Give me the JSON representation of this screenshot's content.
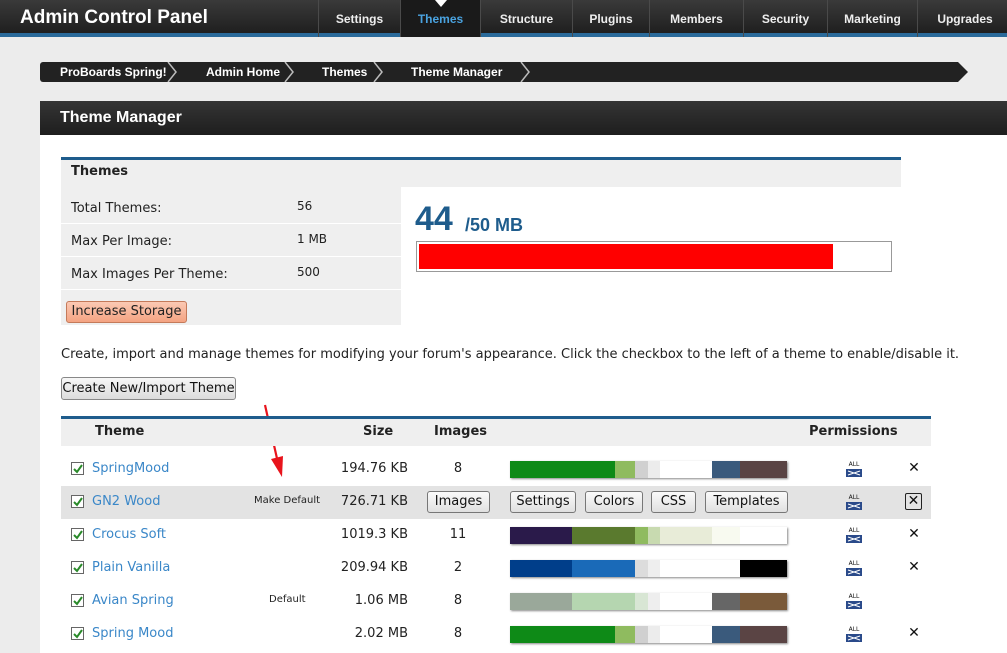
{
  "header": {
    "title": "Admin Control Panel",
    "nav": [
      {
        "label": "Settings",
        "active": false
      },
      {
        "label": "Themes",
        "active": true
      },
      {
        "label": "Structure",
        "active": false
      },
      {
        "label": "Plugins",
        "active": false
      },
      {
        "label": "Members",
        "active": false
      },
      {
        "label": "Security",
        "active": false
      },
      {
        "label": "Marketing",
        "active": false
      },
      {
        "label": "Upgrades",
        "active": false
      }
    ]
  },
  "breadcrumb": [
    "ProBoards Spring!",
    "Admin Home",
    "Themes",
    "Theme Manager"
  ],
  "page_title": "Theme Manager",
  "stats": {
    "heading": "Themes",
    "total_label": "Total Themes:",
    "total_value": "56",
    "max_image_label": "Max Per Image:",
    "max_image_value": "1 MB",
    "max_images_label": "Max Images Per Theme:",
    "max_images_value": "500",
    "increase_button": "Increase Storage"
  },
  "storage": {
    "used": "44",
    "max": "/50 MB",
    "fraction": 0.88,
    "bar_color": "#ff0000"
  },
  "intro_text": "Create, import and manage themes for modifying your forum's appearance. Click the checkbox to the left of a theme to enable/disable it.",
  "create_button": "Create New/Import Theme",
  "table": {
    "headers": {
      "theme": "Theme",
      "size": "Size",
      "images": "Images",
      "permissions": "Permissions"
    },
    "row_buttons": {
      "images": "Images",
      "settings": "Settings",
      "colors": "Colors",
      "css": "CSS",
      "templates": "Templates"
    },
    "permission_icon": "all-users-icon",
    "rows": [
      {
        "name": "SpringMood",
        "note": "",
        "size": "194.76 KB",
        "images": "8",
        "hover": false,
        "delete": true,
        "palette": [
          "#0e8a17",
          "#0e8a17",
          "#8fbb5f",
          "#d0d0d0",
          "#ececec",
          "#ffffff",
          "#3a5a7c",
          "#5a4444"
        ]
      },
      {
        "name": "GN2 Wood",
        "note": "Make Default",
        "size": "726.71 KB",
        "images": "",
        "hover": true,
        "delete": true,
        "palette": []
      },
      {
        "name": "Crocus Soft",
        "note": "",
        "size": "1019.3 KB",
        "images": "11",
        "hover": false,
        "delete": true,
        "palette": [
          "#2a1a4a",
          "#5a7a2e",
          "#5a7a2e",
          "#8fbb5f",
          "#c8dab0",
          "#e8ecd8",
          "#f8faf0",
          "#ffffff"
        ]
      },
      {
        "name": "Plain Vanilla",
        "note": "",
        "size": "209.94 KB",
        "images": "2",
        "hover": false,
        "delete": true,
        "palette": [
          "#003e8a",
          "#1a6ab8",
          "#1a6ab8",
          "#dcdcdc",
          "#eeeeee",
          "#ffffff",
          "#ffffff",
          "#000000"
        ]
      },
      {
        "name": "Avian Spring",
        "note": "Default",
        "size": "1.06 MB",
        "images": "8",
        "hover": false,
        "delete": false,
        "palette": [
          "#9aa89a",
          "#b5d6b0",
          "#b5d6b0",
          "#d8e6d4",
          "#eeeeee",
          "#ffffff",
          "#666666",
          "#7a5a3a"
        ]
      },
      {
        "name": "Spring Mood",
        "note": "",
        "size": "2.02 MB",
        "images": "8",
        "hover": false,
        "delete": true,
        "palette": [
          "#0e8a17",
          "#0e8a17",
          "#8fbb5f",
          "#d0d0d0",
          "#ececec",
          "#ffffff",
          "#3a5a7c",
          "#5a4444"
        ]
      }
    ]
  }
}
